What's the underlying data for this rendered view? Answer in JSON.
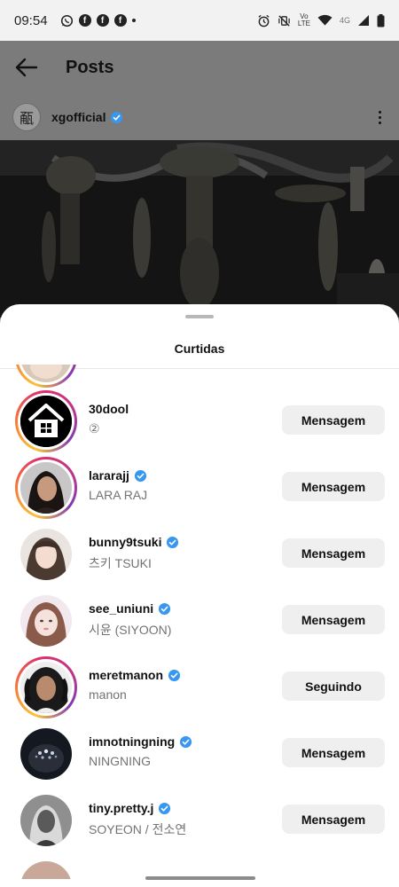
{
  "status_bar": {
    "time": "09:54",
    "network": "4G",
    "volte_top": "Vo",
    "volte_bottom": "LTE"
  },
  "header": {
    "title": "Posts"
  },
  "post": {
    "username": "xgofficial",
    "avatar_glyph": "㼧"
  },
  "sheet": {
    "title": "Curtidas"
  },
  "likes": [
    {
      "username": "30dool",
      "fullname": "②",
      "verified": false,
      "button": "Mensagem"
    },
    {
      "username": "lararajj",
      "fullname": "LARA RAJ",
      "verified": true,
      "button": "Mensagem"
    },
    {
      "username": "bunny9tsuki",
      "fullname": "츠키 TSUKI",
      "verified": true,
      "button": "Mensagem"
    },
    {
      "username": "see_uniuni",
      "fullname": "시윤 (SIYOON)",
      "verified": true,
      "button": "Mensagem"
    },
    {
      "username": "meretmanon",
      "fullname": "manon",
      "verified": true,
      "button": "Seguindo"
    },
    {
      "username": "imnotningning",
      "fullname": "NINGNING",
      "verified": true,
      "button": "Mensagem"
    },
    {
      "username": "tiny.pretty.j",
      "fullname": "SOYEON / 전소연",
      "verified": true,
      "button": "Mensagem"
    }
  ],
  "colors": {
    "verified": "#3897f0",
    "button_bg": "#efefef",
    "secondary_text": "#737373"
  }
}
